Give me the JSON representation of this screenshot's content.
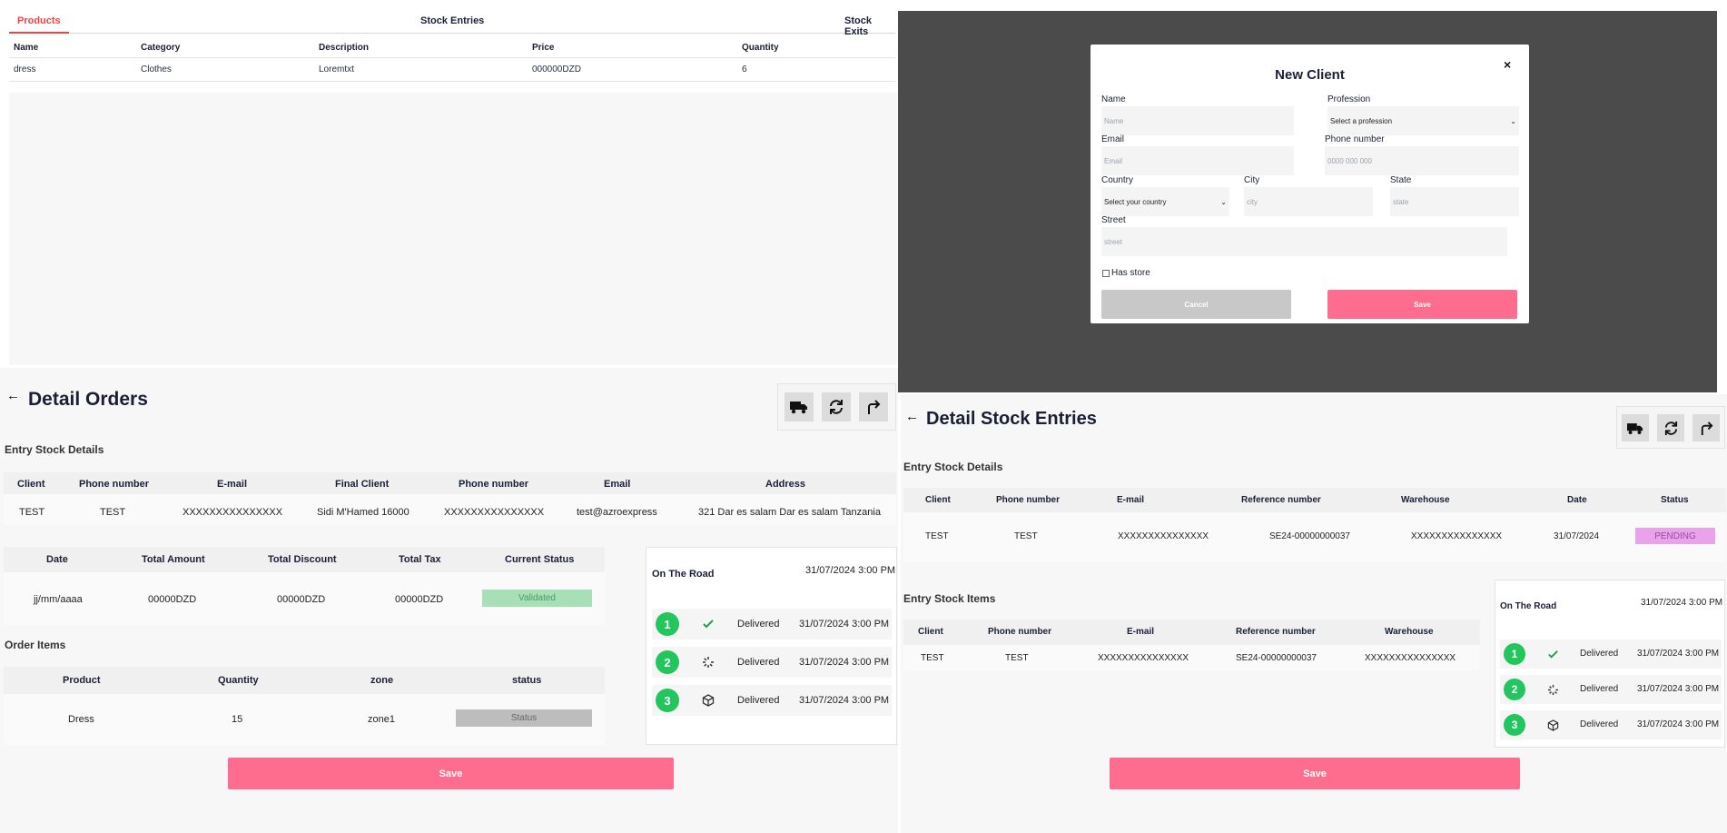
{
  "products": {
    "tabs": [
      "Products",
      "Stock Entries",
      "Stock Exits"
    ],
    "columns": [
      "Name",
      "Category",
      "Description",
      "Price",
      "Quantity"
    ],
    "rows": [
      [
        "dress",
        "Clothes",
        "Loremtxt",
        "000000DZD",
        "6"
      ]
    ]
  },
  "modal": {
    "title": "New Client",
    "close": "×",
    "name_label": "Name",
    "name_placeholder": "Name",
    "profession_label": "Profession",
    "profession_value": "Select a profession",
    "email_label": "Email",
    "email_placeholder": "Email",
    "phone_label": "Phone number",
    "phone_placeholder": "0000 000 000",
    "country_label": "Country",
    "country_value": "Select your country",
    "city_label": "City",
    "city_placeholder": "city",
    "state_label": "State",
    "state_placeholder": "state",
    "street_label": "Street",
    "street_placeholder": "street",
    "has_store_label": "Has store",
    "cancel_label": "Cancel",
    "save_label": "Save"
  },
  "orders": {
    "title": "Detail Orders",
    "entry_section": "Entry Stock Details",
    "entry_columns": [
      "Client",
      "Phone number",
      "E-mail",
      "Final Client",
      "Phone number",
      "Email",
      "Address"
    ],
    "entry_row": [
      "TEST",
      "TEST",
      "XXXXXXXXXXXXXXX",
      "Sidi M'Hamed 16000",
      "XXXXXXXXXXXXXXX",
      "test@azroexpress",
      "321 Dar es salam Dar es salam Tanzania"
    ],
    "summary_columns": [
      "Date",
      "Total Amount",
      "Total Discount",
      "Total Tax",
      "Current Status"
    ],
    "summary_row": [
      "jj/mm/aaaa",
      "00000DZD",
      "00000DZD",
      "00000DZD"
    ],
    "status": "Validated",
    "items_section": "Order Items",
    "items_columns": [
      "Product",
      "Quantity",
      "zone",
      "status"
    ],
    "items_row": [
      "Dress",
      "15",
      "zone1"
    ],
    "item_status": "Status",
    "save_label": "Save",
    "timeline": {
      "head": "On The Road",
      "head_date": "31/07/2024 3:00 PM",
      "steps": [
        {
          "num": "1",
          "icon": "check-icon",
          "label": "Delivered",
          "date": "31/07/2024 3:00 PM"
        },
        {
          "num": "2",
          "icon": "loader-icon",
          "label": "Delivered",
          "date": "31/07/2024 3:00 PM"
        },
        {
          "num": "3",
          "icon": "package-icon",
          "label": "Delivered",
          "date": "31/07/2024 3:00 PM"
        }
      ]
    }
  },
  "entries": {
    "title": "Detail Stock Entries",
    "details_section": "Entry Stock Details",
    "details_columns": [
      "Client",
      "Phone number",
      "E-mail",
      "Reference number",
      "Warehouse",
      "Date",
      "Status"
    ],
    "details_row": [
      "TEST",
      "TEST",
      "XXXXXXXXXXXXXXX",
      "SE24-00000000037",
      "XXXXXXXXXXXXXXX",
      "31/07/2024"
    ],
    "status": "PENDING",
    "items_section": "Entry Stock Items",
    "items_columns": [
      "Client",
      "Phone number",
      "E-mail",
      "Reference number",
      "Warehouse"
    ],
    "items_row": [
      "TEST",
      "TEST",
      "XXXXXXXXXXXXXXX",
      "SE24-00000000037",
      "XXXXXXXXXXXXXXX"
    ],
    "save_label": "Save",
    "timeline": {
      "head": "On The Road",
      "head_date": "31/07/2024 3:00 PM",
      "steps": [
        {
          "num": "1",
          "icon": "check-icon",
          "label": "Delivered",
          "date": "31/07/2024 3:00 PM"
        },
        {
          "num": "2",
          "icon": "loader-icon",
          "label": "Delivered",
          "date": "31/07/2024 3:00 PM"
        },
        {
          "num": "3",
          "icon": "package-icon",
          "label": "Delivered",
          "date": "31/07/2024 3:00 PM"
        }
      ]
    }
  },
  "colors": {
    "accent_red": "#ef4444",
    "save_pink": "#fe6d8d",
    "validated_bg": "#a7dfb7",
    "pending_bg": "#e8a3ea",
    "status_grey": "#bdbdbd",
    "step_green": "#22c55e"
  }
}
